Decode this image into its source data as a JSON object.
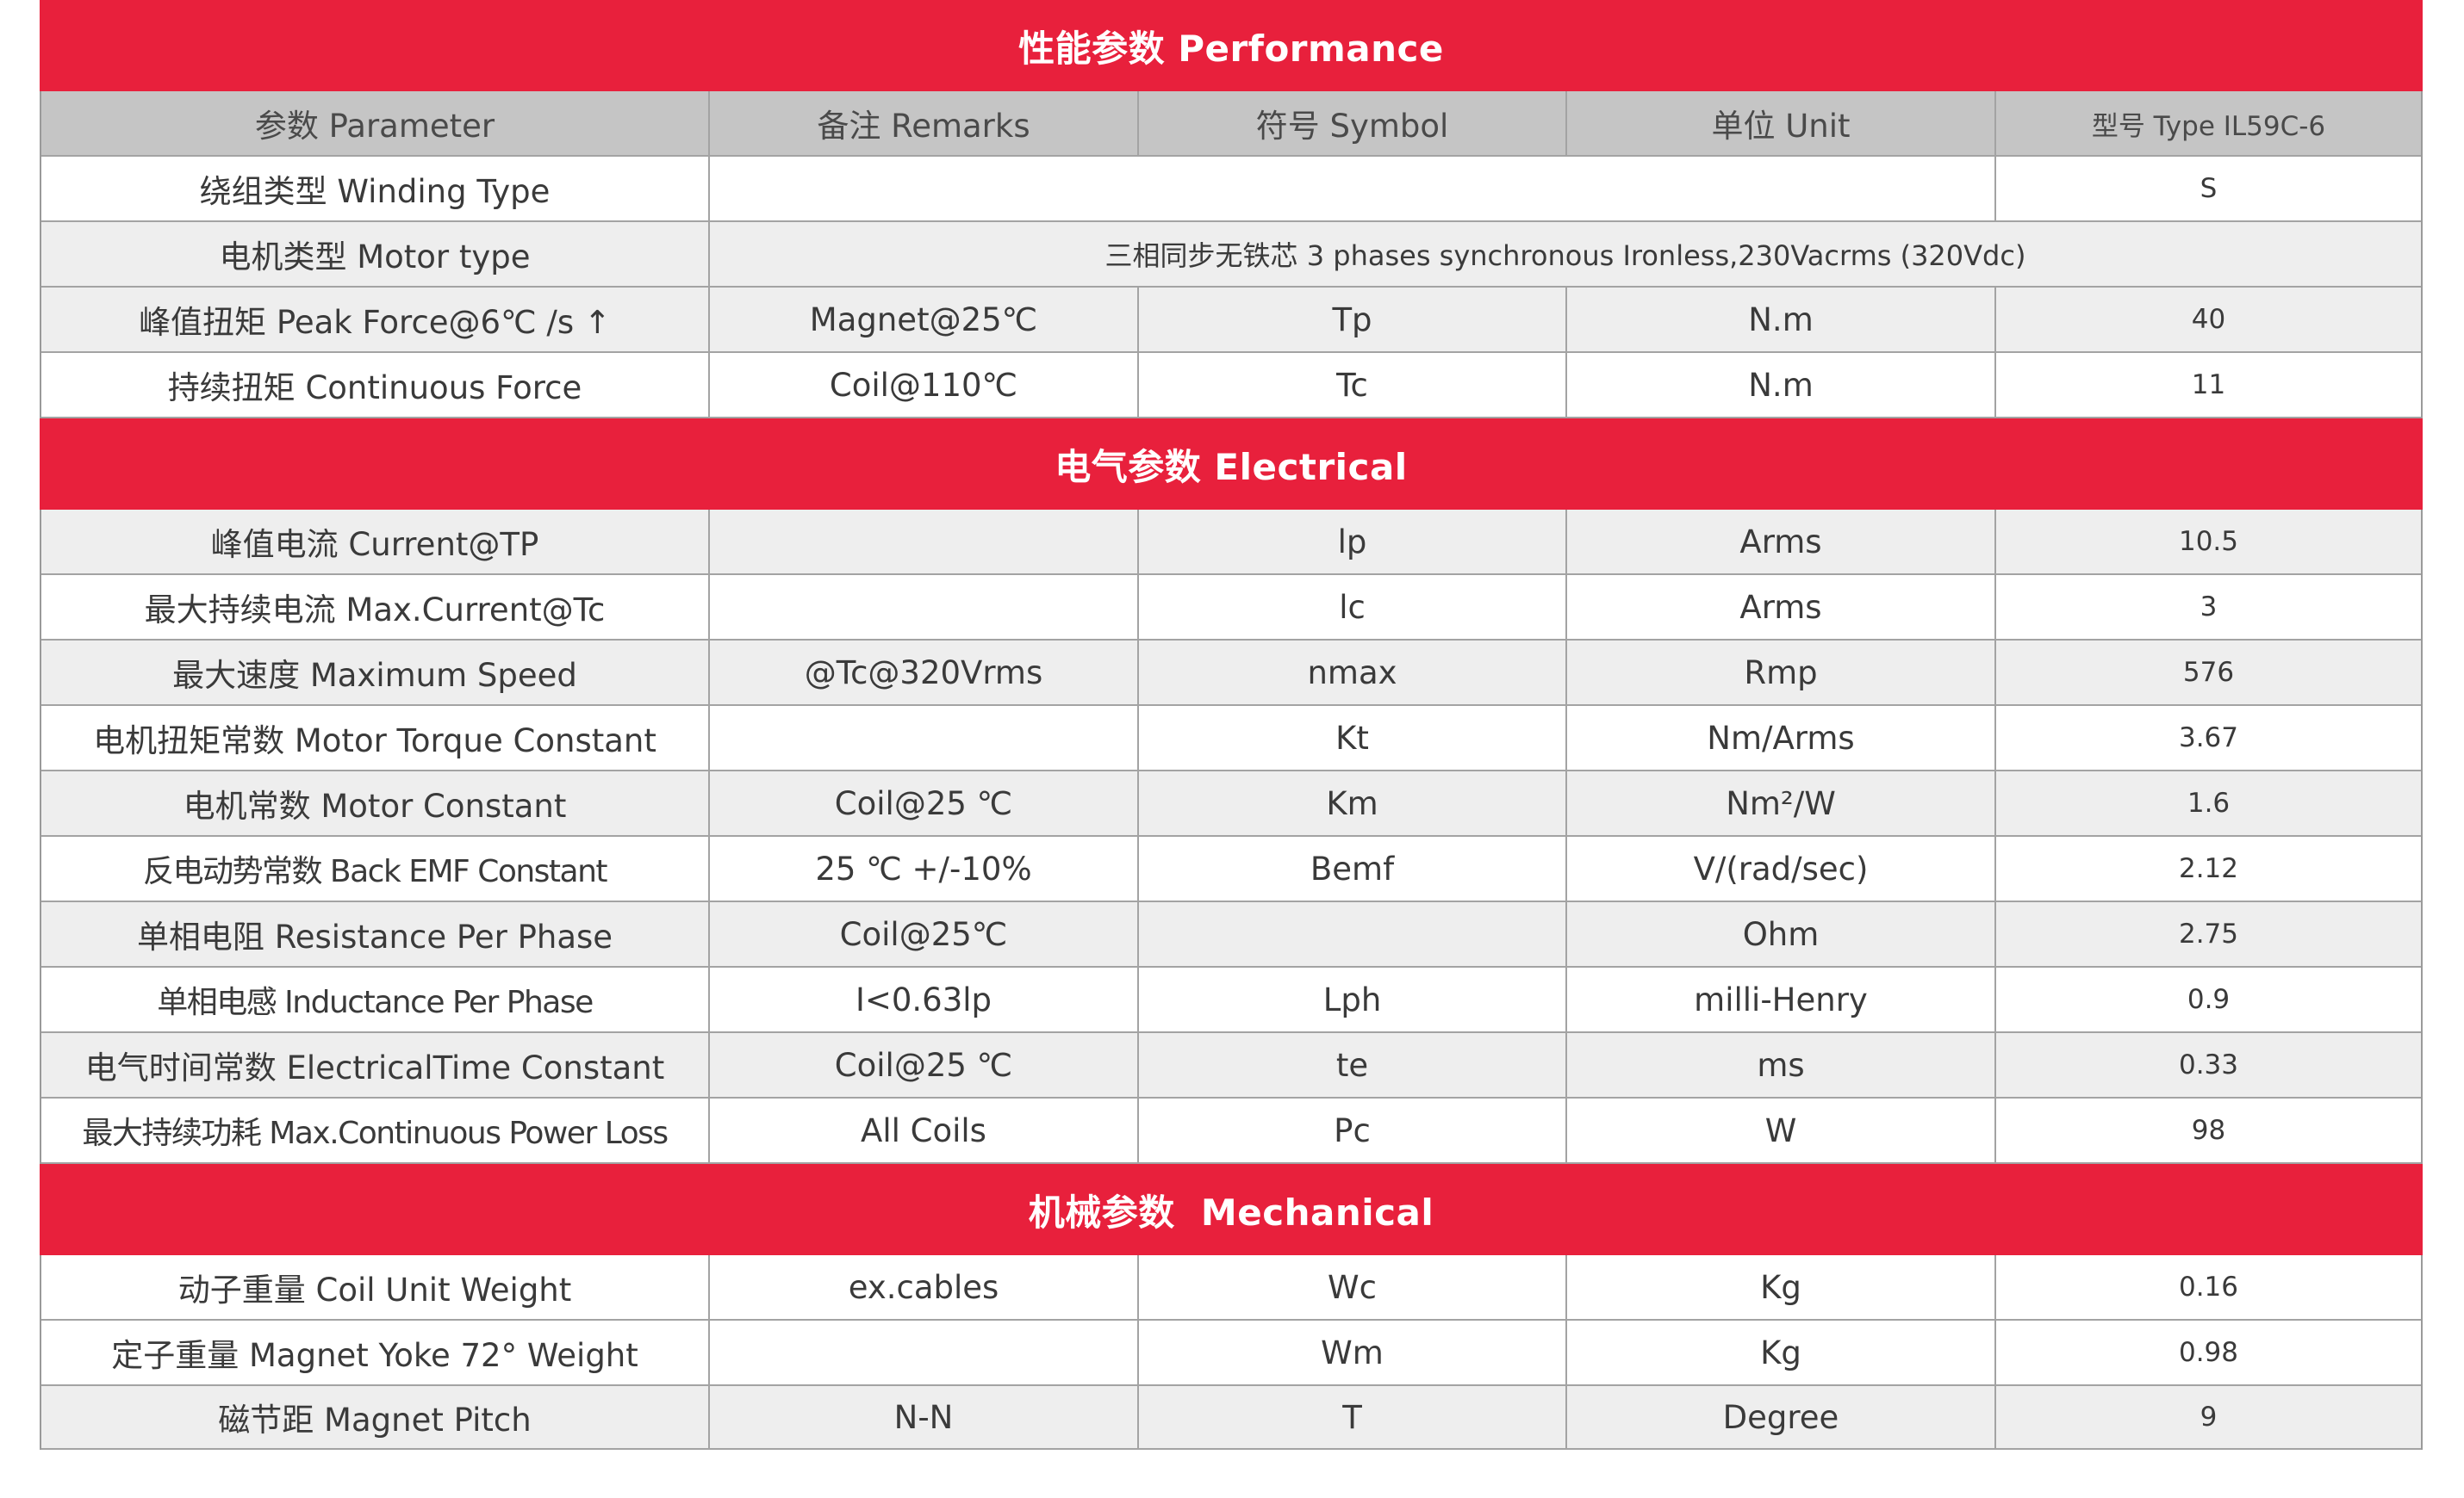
{
  "sections": {
    "performance": "性能参数 Performance",
    "electrical": "电气参数 Electrical",
    "mechanical": "机械参数  Mechanical"
  },
  "columns": {
    "parameter": "参数 Parameter",
    "remarks": "备注 Remarks",
    "symbol": "符号 Symbol",
    "unit": "单位 Unit",
    "type": "型号 Type IL59C-6"
  },
  "performance": {
    "winding": {
      "parameter": "绕组类型 Winding Type",
      "value": "S"
    },
    "motor_type": {
      "parameter": "电机类型 Motor type",
      "value": "三相同步无铁芯 3 phases synchronous Ironless,230Vacrms (320Vdc)"
    },
    "rows": [
      {
        "parameter": "峰值扭矩 Peak Force@6℃ /s ↑",
        "remarks": "Magnet@25℃",
        "symbol": "Tp",
        "unit": "N.m",
        "value": "40"
      },
      {
        "parameter": "持续扭矩 Continuous Force",
        "remarks": "Coil@110℃",
        "symbol": "Tc",
        "unit": "N.m",
        "value": "11"
      }
    ]
  },
  "electrical": [
    {
      "parameter": "峰值电流 Current@TP",
      "remarks": "",
      "symbol": "lp",
      "unit": "Arms",
      "value": "10.5"
    },
    {
      "parameter": "最大持续电流 Max.Current@Tc",
      "remarks": "",
      "symbol": "lc",
      "unit": "Arms",
      "value": "3"
    },
    {
      "parameter": "最大速度 Maximum Speed",
      "remarks": "@Tc@320Vrms",
      "symbol": "nmax",
      "unit": "Rmp",
      "value": "576"
    },
    {
      "parameter": "电机扭矩常数 Motor Torque Constant",
      "remarks": "",
      "symbol": "Kt",
      "unit": "Nm/Arms",
      "value": "3.67"
    },
    {
      "parameter": "电机常数 Motor Constant",
      "remarks": "Coil@25 ℃",
      "symbol": "Km",
      "unit": "Nm²/W",
      "value": "1.6"
    },
    {
      "parameter": "反电动势常数 Back EMF Constant",
      "remarks": "25 ℃ +/-10%",
      "symbol": "Bemf",
      "unit": "V/(rad/sec)",
      "value": "2.12"
    },
    {
      "parameter": "单相电阻 Resistance Per Phase",
      "remarks": "Coil@25℃",
      "symbol": "",
      "unit": "Ohm",
      "value": "2.75"
    },
    {
      "parameter": "单相电感 Inductance Per Phase",
      "remarks": "I<0.63lp",
      "symbol": "Lph",
      "unit": "milli-Henry",
      "value": "0.9"
    },
    {
      "parameter": "电气时间常数 ElectricalTime Constant",
      "remarks": "Coil@25 ℃",
      "symbol": "te",
      "unit": "ms",
      "value": "0.33"
    },
    {
      "parameter": "最大持续功耗 Max.Continuous Power Loss",
      "remarks": "All Coils",
      "symbol": "Pc",
      "unit": "W",
      "value": "98"
    }
  ],
  "mechanical": [
    {
      "parameter": "动子重量 Coil Unit Weight",
      "remarks": "ex.cables",
      "symbol": "Wc",
      "unit": "Kg",
      "value": "0.16"
    },
    {
      "parameter": "定子重量 Magnet Yoke 72° Weight",
      "remarks": "",
      "symbol": "Wm",
      "unit": "Kg",
      "value": "0.98"
    },
    {
      "parameter": "磁节距 Magnet Pitch",
      "remarks": "N-N",
      "symbol": "T",
      "unit": "Degree",
      "value": "9"
    }
  ]
}
